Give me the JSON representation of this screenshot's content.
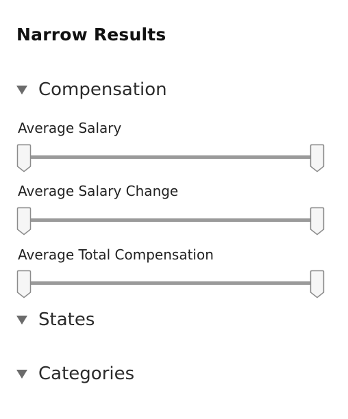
{
  "panel": {
    "title": "Narrow Results"
  },
  "sections": {
    "compensation": {
      "label": "Compensation",
      "icon": "triangle-down-icon",
      "expanded": true,
      "filters": [
        {
          "label": "Average Salary",
          "range_min_fraction": 0,
          "range_max_fraction": 1
        },
        {
          "label": "Average Salary Change",
          "range_min_fraction": 0,
          "range_max_fraction": 1
        },
        {
          "label": "Average Total Compensation",
          "range_min_fraction": 0,
          "range_max_fraction": 1
        }
      ]
    },
    "states": {
      "label": "States",
      "icon": "triangle-down-icon"
    },
    "categories": {
      "label": "Categories",
      "icon": "triangle-down-icon"
    }
  },
  "colors": {
    "track": "#9a9a9a",
    "triangle": "#6b6b6b",
    "handle_border": "#8c8c8c",
    "handle_fill": "#f6f6f6"
  }
}
